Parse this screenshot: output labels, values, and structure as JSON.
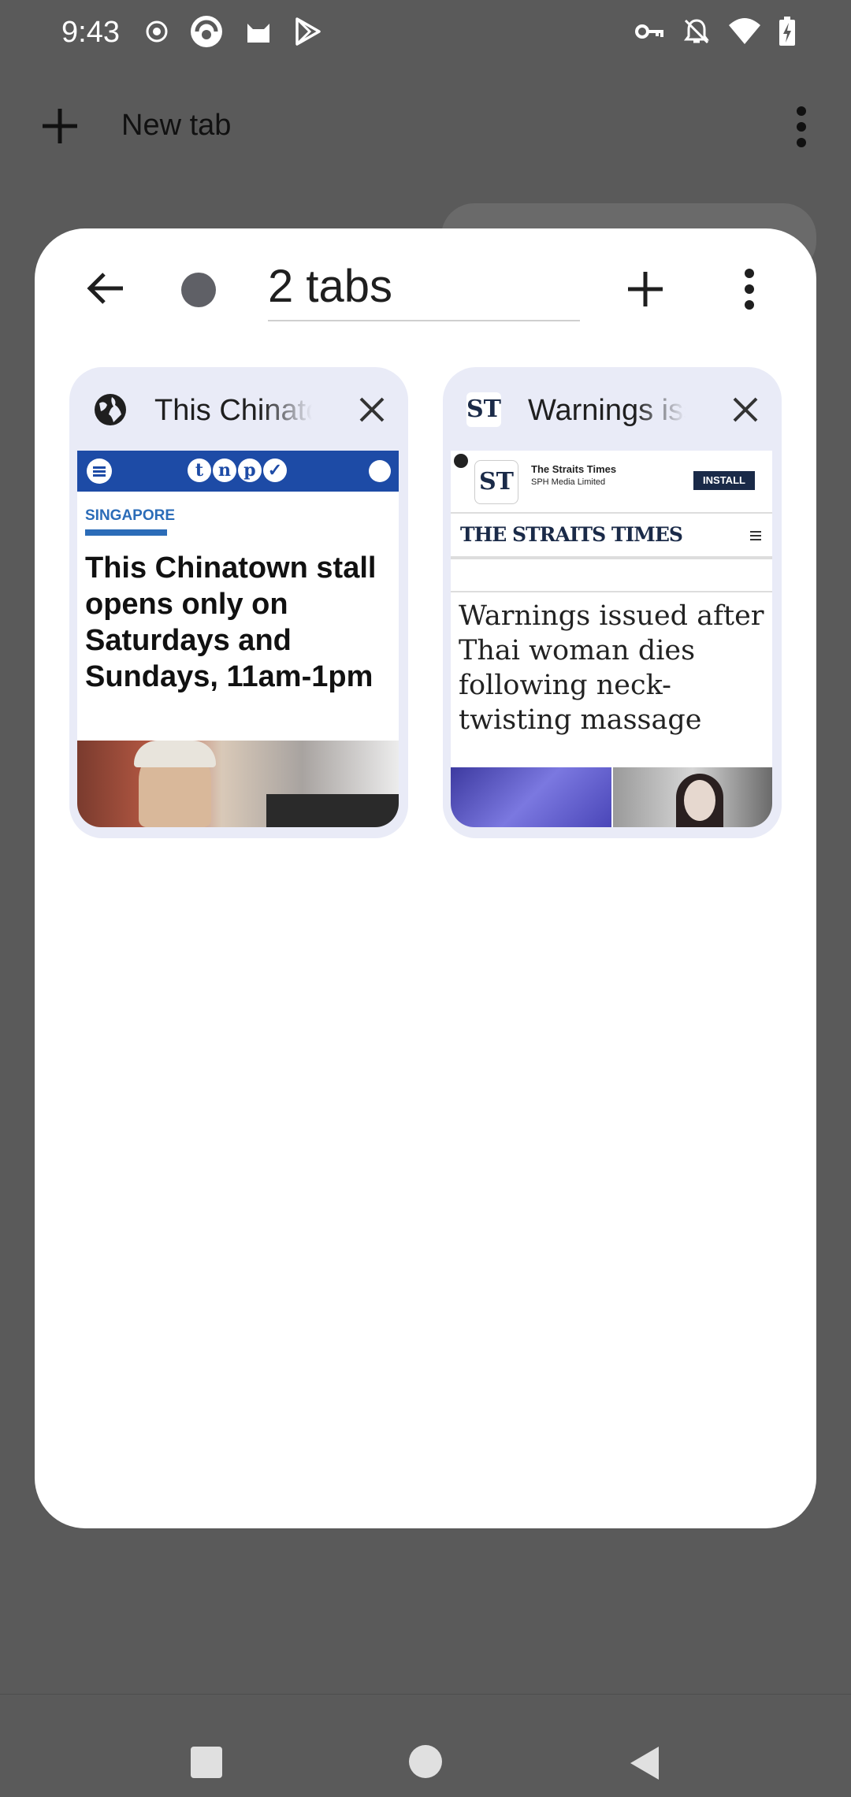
{
  "status": {
    "time": "9:43"
  },
  "topbar": {
    "title": "New tab"
  },
  "tab_group": {
    "title": "2 tabs",
    "tabs": [
      {
        "title": "This Chinatown stall opens only on Saturdays and Sundays, 11am-1pm",
        "preview": {
          "logo_letters": [
            "t",
            "n",
            "p",
            "✓"
          ],
          "category": "SINGAPORE",
          "headline": "This Chinatown stall opens only on Saturdays and Sundays, 11am-1pm"
        }
      },
      {
        "title": "Warnings issued after Thai woman dies following neck-twisting massage",
        "preview": {
          "app_icon": "ST",
          "app_name": "The Straits Times",
          "app_publisher": "SPH Media Limited",
          "install_label": "INSTALL",
          "masthead": "THE STRAITS TIMES",
          "headline": "Warnings issued after Thai woman dies following neck-twisting massage"
        }
      }
    ]
  },
  "colors": {
    "accent": "#1d4ba6",
    "card": "#e9ebf7",
    "scrim": "#5a5a5a"
  }
}
